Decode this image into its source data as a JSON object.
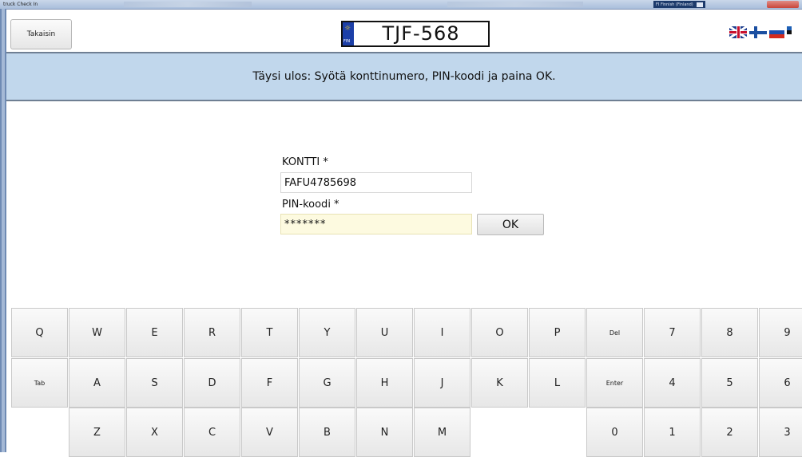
{
  "window": {
    "title": "truck Check In",
    "language_indicator": "FI Finnish (Finland)"
  },
  "header": {
    "back_label": "Takaisin",
    "plate_country": "FIN",
    "plate_number": "TJF-568",
    "flags": [
      "uk-flag-icon",
      "finland-flag-icon",
      "russia-flag-icon",
      "estonia-flag-icon"
    ]
  },
  "banner": {
    "text": "Täysi ulos: Syötä konttinumero, PIN-koodi ja paina OK."
  },
  "form": {
    "container_label": "KONTTI *",
    "container_value": "FAFU4785698",
    "pin_label": "PIN-koodi *",
    "pin_value": "*******",
    "ok_label": "OK"
  },
  "keyboard": {
    "row1": [
      "Q",
      "W",
      "E",
      "R",
      "T",
      "Y",
      "U",
      "I",
      "O",
      "P",
      "Del",
      "7",
      "8",
      "9"
    ],
    "row2": [
      "Tab",
      "A",
      "S",
      "D",
      "F",
      "G",
      "H",
      "J",
      "K",
      "L",
      "Enter",
      "4",
      "5",
      "6"
    ],
    "row3": [
      "Z",
      "X",
      "C",
      "V",
      "B",
      "N",
      "M",
      "0",
      "1",
      "2",
      "3"
    ]
  },
  "colors": {
    "banner_bg": "#c1d7ec",
    "pin_field_bg": "#fdfae0",
    "plate_eu_blue": "#1c3fa8"
  }
}
